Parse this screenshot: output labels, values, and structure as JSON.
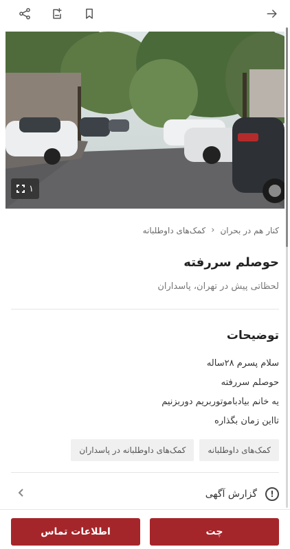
{
  "topbar": {
    "icons": [
      "arrow-right-icon",
      "bookmark-icon",
      "note-add-icon",
      "share-icon"
    ]
  },
  "photo": {
    "counter": "۱"
  },
  "breadcrumb": {
    "items": [
      "کنار هم در بحران",
      "کمک‌های داوطلبانه"
    ]
  },
  "title": "حوصلم سررفته",
  "subtitle": "لحظاتی پیش در تهران، پاسداران",
  "description": {
    "heading": "توضیحات",
    "lines": [
      "سلام پسرم ۲۸ساله",
      "حوصلم سررفته",
      "یه خانم بیادباموتوربریم دوربزنیم",
      "تااین زمان بگذاره"
    ]
  },
  "tags": [
    "کمک‌های داوطلبانه",
    "کمک‌های داوطلبانه در پاسداران"
  ],
  "report": {
    "label": "گزارش آگهی"
  },
  "actions": {
    "chat": "چت",
    "contact": "اطلاعات تماس"
  },
  "colors": {
    "primary_button": "#a5262a"
  }
}
